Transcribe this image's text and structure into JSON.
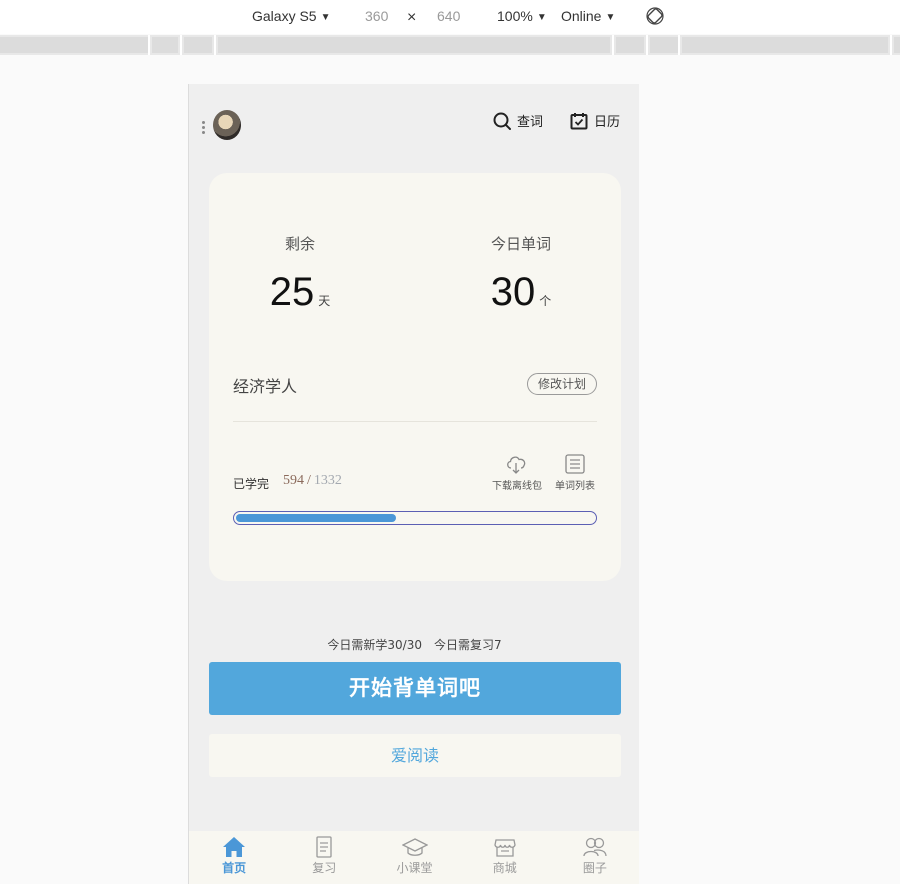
{
  "devtools": {
    "device": "Galaxy S5",
    "width": "360",
    "times": "×",
    "height": "640",
    "zoom": "100%",
    "network": "Online",
    "caret": "▼"
  },
  "header": {
    "search_label": "查词",
    "calendar_label": "日历"
  },
  "stats": {
    "remaining_label": "剩余",
    "remaining_value": "25",
    "remaining_unit": "天",
    "today_label": "今日单词",
    "today_value": "30",
    "today_unit": "个"
  },
  "plan": {
    "name": "经济学人",
    "edit_label": "修改计划"
  },
  "progress": {
    "learned_label": "已学完",
    "learned": "594",
    "separator": "/",
    "total": "1332",
    "fraction": 0.446,
    "download_label": "下载离线包",
    "wordlist_label": "单词列表"
  },
  "daily": {
    "new_label": "今日需新学30/30",
    "review_label": "今日需复习7"
  },
  "actions": {
    "start_label": "开始背单词吧",
    "read_label": "爱阅读"
  },
  "tabs": [
    {
      "label": "首页",
      "icon": "home-icon",
      "active": true
    },
    {
      "label": "复习",
      "icon": "document-icon",
      "active": false
    },
    {
      "label": "小课堂",
      "icon": "graduation-cap-icon",
      "active": false
    },
    {
      "label": "商城",
      "icon": "store-icon",
      "active": false
    },
    {
      "label": "圈子",
      "icon": "people-icon",
      "active": false
    }
  ],
  "colors": {
    "accent": "#52a7dc",
    "card_bg": "#f8f7f1",
    "page_bg": "#efefef",
    "learned_color": "#8b6a5b",
    "total_color": "#a4a9b0"
  }
}
